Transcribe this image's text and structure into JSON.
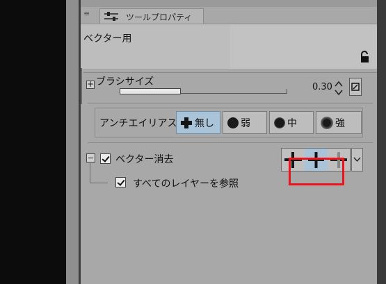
{
  "panel": {
    "tab_label": "ツールプロパティ",
    "tab_icon": "sliders-icon",
    "menu_icon": "hamburger-icon",
    "subtool_name": "ベクター用",
    "lock_icon": "lock-icon"
  },
  "brush_size": {
    "label": "ブラシサイズ",
    "value": "0.30",
    "fill_fraction": 0.36,
    "pressure_icon": "pressure-icon"
  },
  "anti_aliasing": {
    "label": "アンチエイリアス",
    "options": [
      "無し",
      "弱",
      "中",
      "強"
    ],
    "selected": "無し"
  },
  "vector_erase": {
    "label": "ベクター消去",
    "checked": true,
    "modes": [
      "erase-touched-icon",
      "erase-to-intersection-icon",
      "erase-whole-line-icon"
    ],
    "selected_mode_index": 1,
    "sub_option": {
      "label": "すべてのレイヤーを参照",
      "checked": true
    }
  },
  "colors": {
    "selected_bg": "#a9c3d8",
    "highlight": "#e8161c",
    "panel_bg": "#a8a8a8"
  }
}
